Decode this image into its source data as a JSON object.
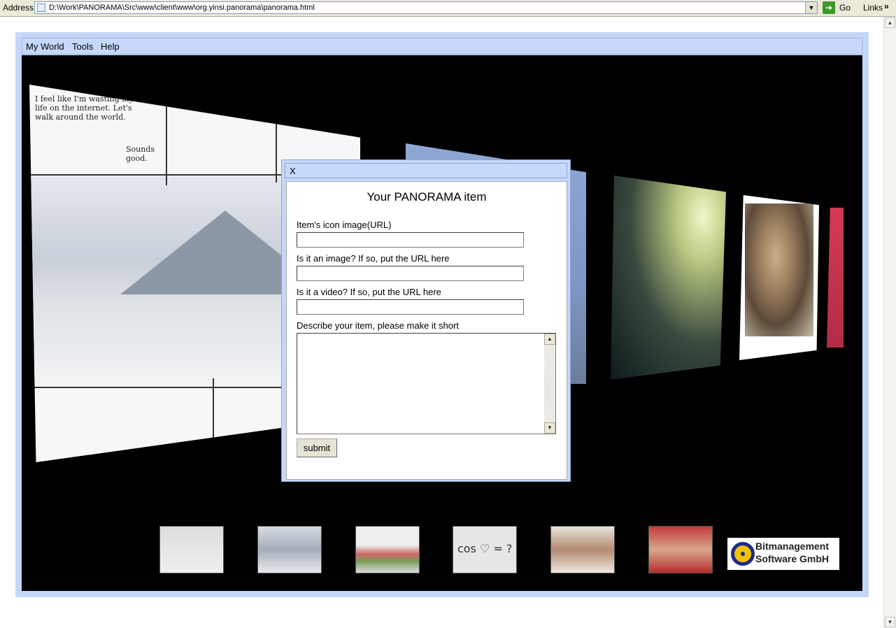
{
  "browser": {
    "address_label": "Address",
    "url": "D:\\Work\\PANORAMA\\Src\\www\\client\\www\\org.yinsi.panorama\\panorama.html",
    "go_label": "Go",
    "links_label": "Links",
    "links_chevron": "»"
  },
  "menu": {
    "items": [
      "My World",
      "Tools",
      "Help"
    ]
  },
  "comic": {
    "text1": "I feel like I'm wasting my life on the internet. Let's walk around the world.",
    "text2": "Sounds good."
  },
  "thumbnails": {
    "eq_text": "cos ♡ = ?"
  },
  "logo": {
    "line1": "Bitmanagement",
    "line2": "Software GmbH"
  },
  "dialog": {
    "close_label": "X",
    "title": "Your PANORAMA item",
    "icon_label": "Item's icon image(URL)",
    "icon_value": "",
    "image_label": "Is it an image? If so, put the URL here",
    "image_value": "",
    "video_label": "Is it a video? If so, put the URL here",
    "video_value": "",
    "desc_label": "Describe your item, please make it short",
    "desc_value": "",
    "submit_label": "submit"
  }
}
